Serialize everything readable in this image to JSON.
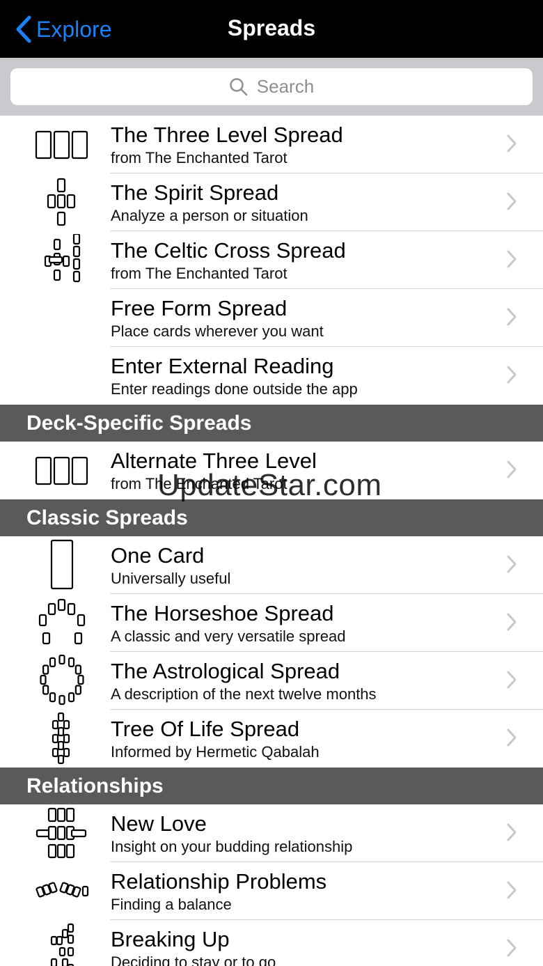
{
  "nav": {
    "back_label": "Explore",
    "title": "Spreads"
  },
  "search": {
    "placeholder": "Search"
  },
  "watermark": "UpdateStar.com",
  "groups": [
    {
      "header": "",
      "items": [
        {
          "title": "The Three Level Spread",
          "subtitle": "from The Enchanted Tarot",
          "icon": "three-card-row-icon"
        },
        {
          "title": "The Spirit Spread",
          "subtitle": "Analyze a person or situation",
          "icon": "spirit-spread-icon"
        },
        {
          "title": "The Celtic Cross Spread",
          "subtitle": "from The Enchanted Tarot",
          "icon": "celtic-cross-icon"
        },
        {
          "title": "Free Form Spread",
          "subtitle": "Place cards wherever you want",
          "icon": ""
        },
        {
          "title": "Enter External Reading",
          "subtitle": "Enter readings done outside the app",
          "icon": ""
        }
      ]
    },
    {
      "header": "Deck-Specific Spreads",
      "items": [
        {
          "title": "Alternate Three Level",
          "subtitle": "from The Enchanted Tarot",
          "icon": "three-card-row-icon"
        }
      ]
    },
    {
      "header": "Classic Spreads",
      "items": [
        {
          "title": "One Card",
          "subtitle": "Universally useful",
          "icon": "single-card-icon"
        },
        {
          "title": "The Horseshoe Spread",
          "subtitle": "A classic and very versatile spread",
          "icon": "horseshoe-icon"
        },
        {
          "title": "The Astrological Spread",
          "subtitle": "A description of the next twelve months",
          "icon": "astrological-circle-icon"
        },
        {
          "title": "Tree Of Life Spread",
          "subtitle": "Informed by Hermetic Qabalah",
          "icon": "tree-of-life-icon"
        }
      ]
    },
    {
      "header": "Relationships",
      "items": [
        {
          "title": "New Love",
          "subtitle": "Insight on your budding relationship",
          "icon": "new-love-icon"
        },
        {
          "title": "Relationship Problems",
          "subtitle": "Finding a balance",
          "icon": "relationship-problems-icon"
        },
        {
          "title": "Breaking Up",
          "subtitle": "Deciding to stay or to go",
          "icon": "breaking-up-icon"
        }
      ]
    }
  ],
  "colors": {
    "accent": "#1a82f7",
    "section_bg": "#5a5a5c",
    "navbar_bg": "#000000",
    "searchbar_bg": "#c9c9ce"
  }
}
